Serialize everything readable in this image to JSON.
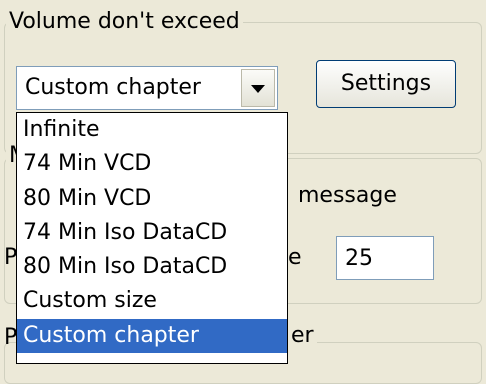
{
  "volume_group": {
    "title": "Volume don't exceed",
    "combo_value": "Custom chapter",
    "settings_button": "Settings",
    "dropdown_items": [
      "Infinite",
      "74 Min VCD",
      "80 Min VCD",
      "74 Min Iso DataCD",
      "80 Min Iso DataCD",
      "Custom size",
      "Custom chapter"
    ],
    "selected_index": 6
  },
  "occluded_group": {
    "title_fragment": "M",
    "message_fragment": "message",
    "label_fragment": "e",
    "left_fragment": "P",
    "field_value": "25"
  },
  "bottom_group": {
    "title_fragment": "er",
    "left_fragment": "P"
  }
}
